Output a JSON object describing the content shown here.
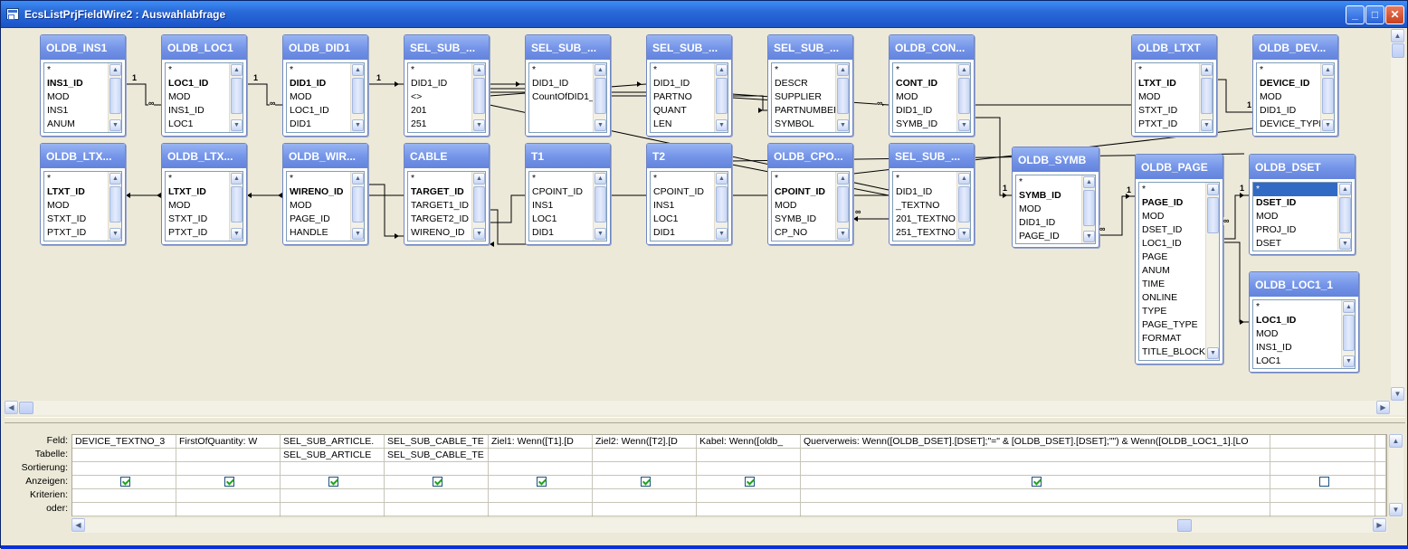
{
  "window": {
    "title": "EcsListPrjFieldWire2 : Auswahlabfrage"
  },
  "tables": [
    {
      "title": "OLDB_INS1",
      "fields": [
        "*",
        "INS1_ID",
        "MOD",
        "INS1",
        "ANUM"
      ],
      "pk": 1
    },
    {
      "title": "OLDB_LOC1",
      "fields": [
        "*",
        "LOC1_ID",
        "MOD",
        "INS1_ID",
        "LOC1"
      ],
      "pk": 1
    },
    {
      "title": "OLDB_DID1",
      "fields": [
        "*",
        "DID1_ID",
        "MOD",
        "LOC1_ID",
        "DID1"
      ],
      "pk": 1
    },
    {
      "title": "SEL_SUB_...",
      "fields": [
        "*",
        "DID1_ID",
        "<>",
        "201",
        "251"
      ],
      "pk": -1
    },
    {
      "title": "SEL_SUB_...",
      "fields": [
        "*",
        "DID1_ID",
        "CountOfDID1_ID"
      ],
      "pk": -1
    },
    {
      "title": "SEL_SUB_...",
      "fields": [
        "*",
        "DID1_ID",
        "PARTNO",
        "QUANT",
        "LEN"
      ],
      "pk": -1
    },
    {
      "title": "SEL_SUB_...",
      "fields": [
        "*",
        "DESCR",
        "SUPPLIER",
        "PARTNUMBER",
        "SYMBOL"
      ],
      "pk": -1
    },
    {
      "title": "OLDB_CON...",
      "fields": [
        "*",
        "CONT_ID",
        "MOD",
        "DID1_ID",
        "SYMB_ID"
      ],
      "pk": 1
    },
    {
      "title": "OLDB_LTXT",
      "fields": [
        "*",
        "LTXT_ID",
        "MOD",
        "STXT_ID",
        "PTXT_ID"
      ],
      "pk": 1
    },
    {
      "title": "OLDB_DEV...",
      "fields": [
        "*",
        "DEVICE_ID",
        "MOD",
        "DID1_ID",
        "DEVICE_TYPE"
      ],
      "pk": 1
    },
    {
      "title": "OLDB_LTX...",
      "fields": [
        "*",
        "LTXT_ID",
        "MOD",
        "STXT_ID",
        "PTXT_ID"
      ],
      "pk": 1
    },
    {
      "title": "OLDB_LTX...",
      "fields": [
        "*",
        "LTXT_ID",
        "MOD",
        "STXT_ID",
        "PTXT_ID"
      ],
      "pk": 1
    },
    {
      "title": "OLDB_WIR...",
      "fields": [
        "*",
        "WIRENO_ID",
        "MOD",
        "PAGE_ID",
        "HANDLE"
      ],
      "pk": 1
    },
    {
      "title": "CABLE",
      "fields": [
        "*",
        "TARGET_ID",
        "TARGET1_ID",
        "TARGET2_ID",
        "WIRENO_ID"
      ],
      "pk": 1
    },
    {
      "title": "T1",
      "fields": [
        "*",
        "CPOINT_ID",
        "INS1",
        "LOC1",
        "DID1"
      ],
      "pk": -1
    },
    {
      "title": "T2",
      "fields": [
        "*",
        "CPOINT_ID",
        "INS1",
        "LOC1",
        "DID1"
      ],
      "pk": -1
    },
    {
      "title": "OLDB_CPO...",
      "fields": [
        "*",
        "CPOINT_ID",
        "MOD",
        "SYMB_ID",
        "CP_NO"
      ],
      "pk": 1
    },
    {
      "title": "SEL_SUB_...",
      "fields": [
        "*",
        "DID1_ID",
        "_TEXTNO",
        "201_TEXTNO",
        "251_TEXTNO"
      ],
      "pk": -1
    },
    {
      "title": "OLDB_SYMB",
      "fields": [
        "*",
        "SYMB_ID",
        "MOD",
        "DID1_ID",
        "PAGE_ID"
      ],
      "pk": 1
    },
    {
      "title": "OLDB_PAGE",
      "fields": [
        "*",
        "PAGE_ID",
        "MOD",
        "DSET_ID",
        "LOC1_ID",
        "PAGE",
        "ANUM",
        "TIME",
        "ONLINE",
        "TYPE",
        "PAGE_TYPE",
        "FORMAT",
        "TITLE_BLOCK"
      ],
      "pk": 1
    },
    {
      "title": "OLDB_DSET",
      "fields": [
        "*",
        "DSET_ID",
        "MOD",
        "PROJ_ID",
        "DSET"
      ],
      "pk": 1
    },
    {
      "title": "OLDB_LOC1_1",
      "fields": [
        "*",
        "LOC1_ID",
        "MOD",
        "INS1_ID",
        "LOC1"
      ],
      "pk": 1
    }
  ],
  "relation_labels": {
    "one": "1",
    "many": "∞"
  },
  "qbe": {
    "row_labels": [
      "Feld:",
      "Tabelle:",
      "Sortierung:",
      "Anzeigen:",
      "Kriterien:",
      "oder:"
    ],
    "columns": [
      {
        "feld": "DEVICE_TEXTNO_3",
        "tabelle": "",
        "show": true
      },
      {
        "feld": "FirstOfQuantity: W",
        "tabelle": "",
        "show": true
      },
      {
        "feld": "SEL_SUB_ARTICLE.",
        "tabelle": "SEL_SUB_ARTICLE",
        "show": true
      },
      {
        "feld": "SEL_SUB_CABLE_TE",
        "tabelle": "SEL_SUB_CABLE_TE",
        "show": true
      },
      {
        "feld": "Ziel1: Wenn([T1].[D",
        "tabelle": "",
        "show": true
      },
      {
        "feld": "Ziel2: Wenn([T2].[D",
        "tabelle": "",
        "show": true
      },
      {
        "feld": "Kabel: Wenn([oldb_",
        "tabelle": "",
        "show": true
      },
      {
        "feld": "Querverweis: Wenn([OLDB_DSET].[DSET];\"=\" & [OLDB_DSET].[DSET];\"\") & Wenn([OLDB_LOC1_1].[LO",
        "tabelle": "",
        "show": true
      },
      {
        "feld": "",
        "tabelle": "",
        "show": false
      },
      {
        "feld": "",
        "tabelle": "",
        "show": false
      }
    ]
  },
  "icons": {
    "window": "query-window-icon",
    "minimize": "minimize-icon",
    "maximize": "maximize-icon",
    "close": "close-icon"
  }
}
